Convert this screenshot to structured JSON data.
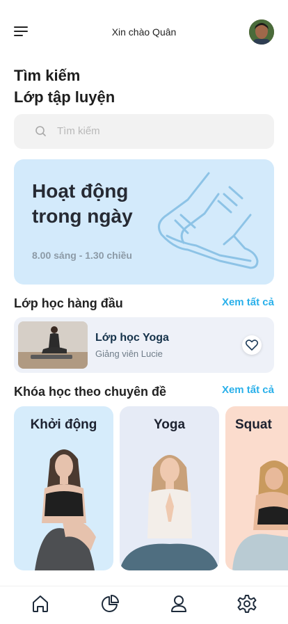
{
  "header": {
    "greeting": "Xin chào Quân",
    "menu_icon": "hamburger-menu-icon",
    "avatar": "user-avatar"
  },
  "title": {
    "line1": "Tìm kiếm",
    "line2": "Lớp tập luyện"
  },
  "search": {
    "placeholder": "Tìm kiếm",
    "icon": "search-icon"
  },
  "banner": {
    "title_line1": "Hoạt động",
    "title_line2": "trong ngày",
    "time": "8.00 sáng - 1.30 chiều",
    "icon": "running-shoes-icon"
  },
  "top_classes": {
    "title": "Lớp học hàng đầu",
    "see_all": "Xem tất cả",
    "items": [
      {
        "name": "Lớp học Yoga",
        "teacher": "Giảng viên Lucie",
        "icon": "heart-icon"
      }
    ]
  },
  "topics": {
    "title": "Khóa học theo chuyên đề",
    "see_all": "Xem tất cả",
    "items": [
      {
        "label": "Khởi động",
        "color": "#d6ecfb"
      },
      {
        "label": "Yoga",
        "color": "#e6ebf6"
      },
      {
        "label": "Squat",
        "color": "#fbdccd"
      }
    ]
  },
  "bottom_nav": {
    "items": [
      "home-icon",
      "pie-chart-icon",
      "profile-icon",
      "settings-icon"
    ]
  }
}
